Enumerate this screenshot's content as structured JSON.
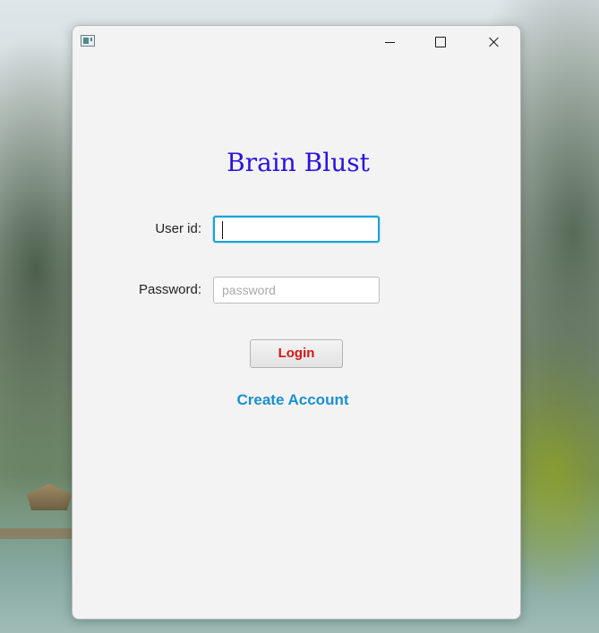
{
  "window": {
    "app_icon": "app-icon",
    "controls": {
      "minimize_icon": "minimize-icon",
      "maximize_icon": "maximize-icon",
      "close_icon": "close-icon"
    }
  },
  "login": {
    "title": "Brain Blust",
    "title_color": "#2b12e0",
    "user_label": "User id:",
    "user_value": "",
    "password_label": "Password:",
    "password_placeholder": "password",
    "login_button": "Login",
    "login_button_color": "#d11616",
    "create_account_link": "Create Account",
    "link_color": "#1a8fcf",
    "focus_color": "#1aa3d6"
  }
}
